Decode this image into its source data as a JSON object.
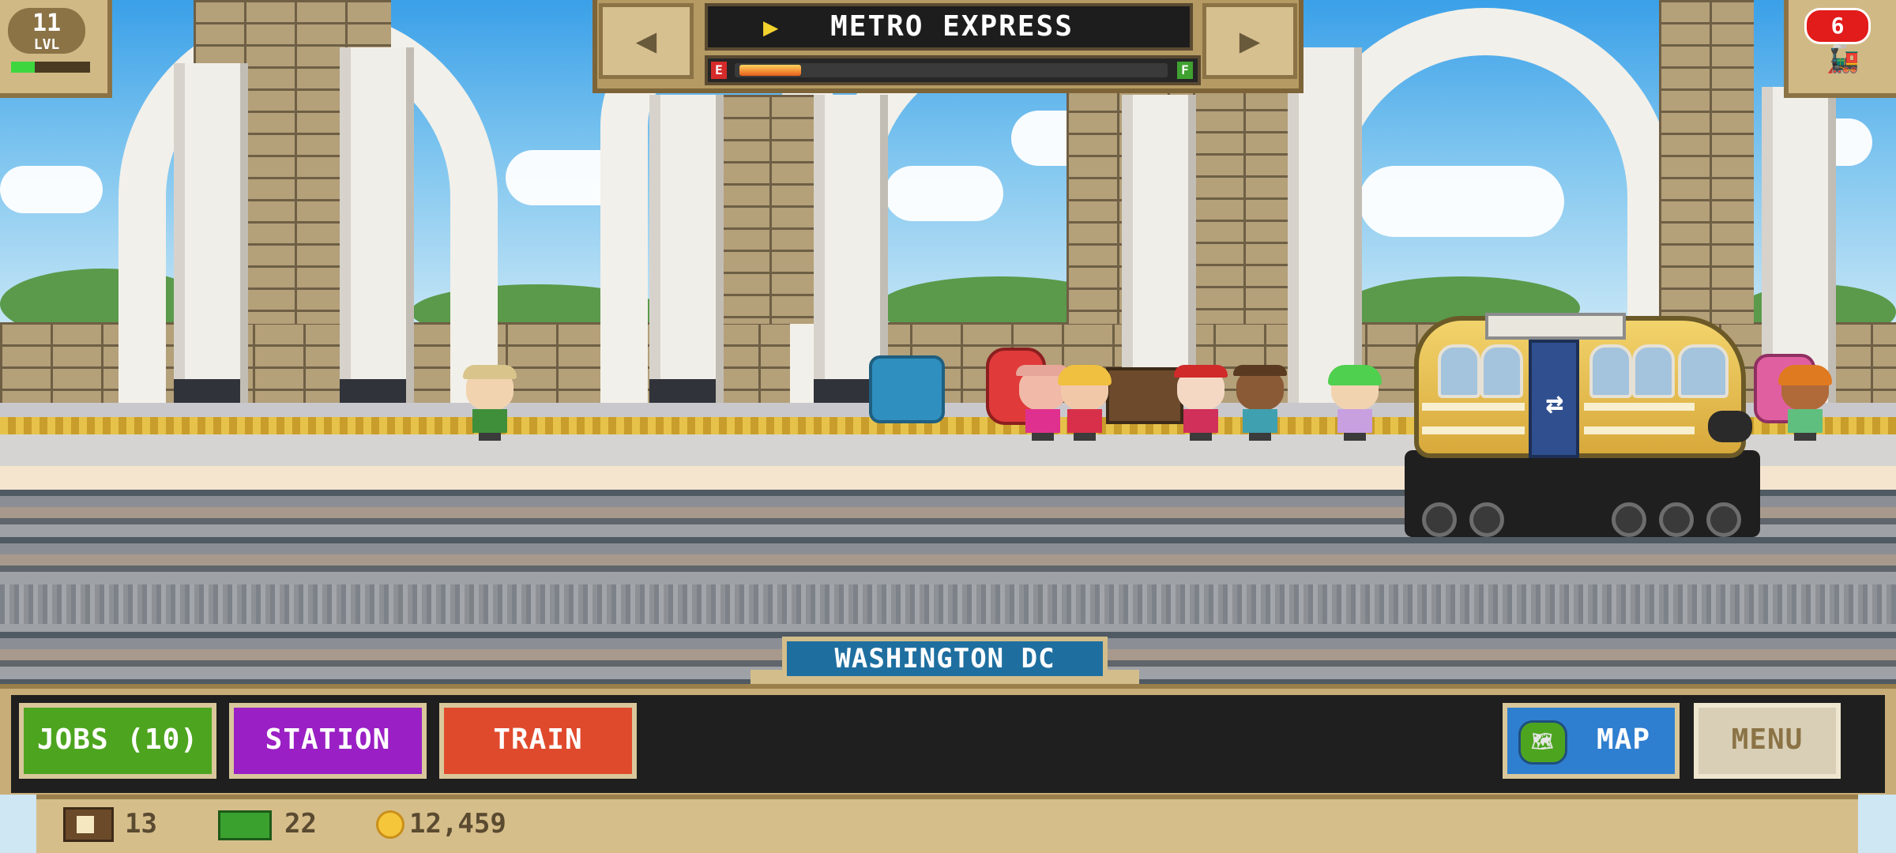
{
  "hud": {
    "level": "11",
    "level_label": "LVL",
    "level_progress": 0.3,
    "trains_count": "6"
  },
  "train_selector": {
    "title": "METRO EXPRESS",
    "fuel_empty_label": "E",
    "fuel_full_label": "F",
    "fuel_level": 0.07,
    "prev_icon": "left-arrow-icon",
    "next_icon": "right-arrow-icon"
  },
  "station": {
    "name": "WASHINGTON DC"
  },
  "buttons": {
    "jobs": "JOBS (10)",
    "station": "STATION",
    "train": "TRAIN",
    "map": "MAP",
    "menu": "MENU"
  },
  "resources": {
    "crates": "13",
    "cash": "22",
    "coins": "12,459"
  },
  "colors": {
    "jobs": "#4da51f",
    "station": "#9a1fc4",
    "train": "#e04a2c",
    "map": "#2f7fd0",
    "menu": "#d9cfb7"
  }
}
